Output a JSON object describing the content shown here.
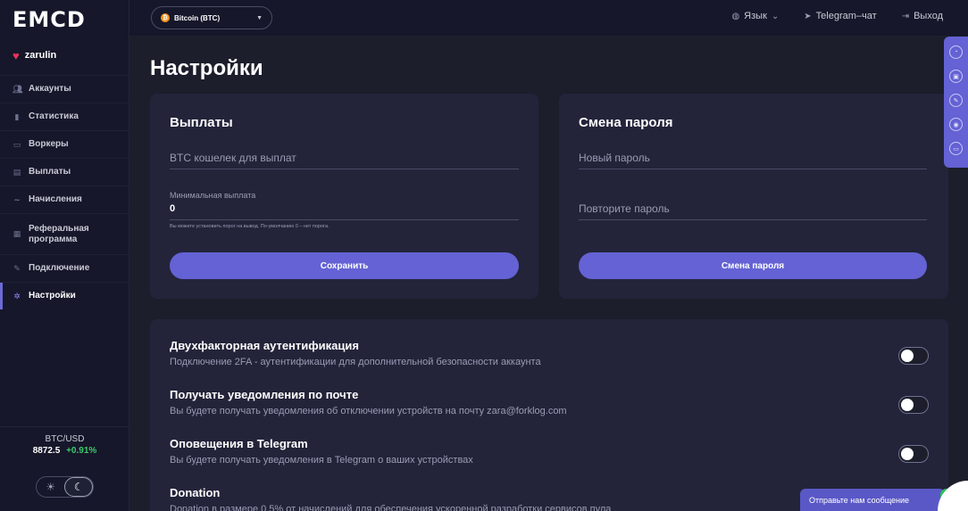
{
  "app": {
    "logo": "EMCD"
  },
  "user": {
    "name": "zarulin"
  },
  "sidebar": {
    "items": [
      {
        "label": "Аккаунты",
        "icon": "users-icon"
      },
      {
        "label": "Статистика",
        "icon": "bar-chart-icon"
      },
      {
        "label": "Воркеры",
        "icon": "monitor-icon"
      },
      {
        "label": "Выплаты",
        "icon": "wallet-icon"
      },
      {
        "label": "Начисления",
        "icon": "trend-icon"
      },
      {
        "label": "Реферальная программа",
        "icon": "document-icon"
      },
      {
        "label": "Подключение",
        "icon": "wrench-icon"
      },
      {
        "label": "Настройки",
        "icon": "gear-icon",
        "active": true
      }
    ]
  },
  "ticker": {
    "pair": "BTC/USD",
    "price": "8872.5",
    "change": "+0.91%"
  },
  "topbar": {
    "coin": "Bitcoin (BTC)",
    "language": "Язык",
    "telegram": "Telegram–чат",
    "logout": "Выход"
  },
  "page": {
    "title": "Настройки"
  },
  "payouts": {
    "title": "Выплаты",
    "wallet_placeholder": "BTC кошелек для выплат",
    "min_label": "Минимальная выплата",
    "min_value": "0",
    "hint": "Вы можете установить порог на вывод. По-умолчанию 0 – нет порога.",
    "save_label": "Сохранить"
  },
  "password": {
    "title": "Смена пароля",
    "new_placeholder": "Новый пароль",
    "repeat_placeholder": "Повторите пароль",
    "submit_label": "Смена пароля"
  },
  "settings": [
    {
      "title": "Двухфакторная аутентификация",
      "desc": "Подключение 2FA - аутентификации для дополнительной безопасности аккаунта",
      "enabled": false
    },
    {
      "title": "Получать уведомления по почте",
      "desc": "Вы будете получать уведомления об отключении устройств на почту zara@forklog.com",
      "enabled": false
    },
    {
      "title": "Оповещения в Telegram",
      "desc": "Вы будете получать уведомления в Telegram о ваших устройствах",
      "enabled": false
    },
    {
      "title": "Donation",
      "desc": "Donation в размере 0.5% от начислений для обеспечения ускоренной разработки сервисов пула"
    }
  ],
  "chat": {
    "label": "Отправьте нам сообщение"
  },
  "colors": {
    "accent": "#6462d4",
    "background": "#1c1e2b",
    "card": "#23243a",
    "positive": "#3ec96b",
    "btc": "#f7931a"
  }
}
